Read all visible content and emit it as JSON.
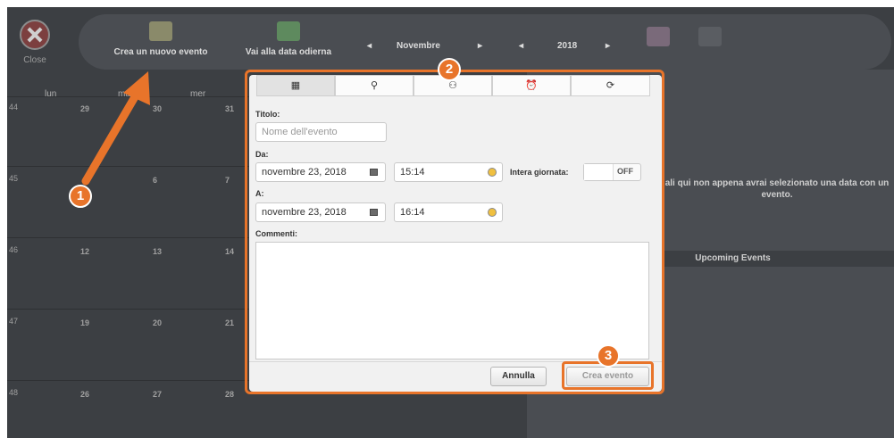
{
  "topbar": {
    "close_label": "Close",
    "new_event_label": "Crea un nuovo evento",
    "today_label": "Vai alla data odierna",
    "month": "Novembre",
    "year": "2018",
    "prev_symbol": "◂",
    "next_symbol": "▸"
  },
  "calendar": {
    "day_headers": [
      "lun",
      "mar",
      "mer"
    ],
    "rows": [
      {
        "week": "44",
        "days": [
          "29",
          "30",
          "31"
        ]
      },
      {
        "week": "45",
        "days": [
          "",
          "6",
          "7"
        ]
      },
      {
        "week": "46",
        "days": [
          "12",
          "13",
          "14"
        ]
      },
      {
        "week": "47",
        "days": [
          "19",
          "20",
          "21"
        ]
      },
      {
        "week": "48",
        "days": [
          "26",
          "27",
          "28"
        ]
      }
    ]
  },
  "right_panel": {
    "message": "ali qui non appena avrai selezionato una data con un evento.",
    "upcoming": "Upcoming Events"
  },
  "dialog": {
    "tabs": [
      {
        "icon": "calendar-icon",
        "glyph": "▦"
      },
      {
        "icon": "location-icon",
        "glyph": "⚲"
      },
      {
        "icon": "people-icon",
        "glyph": "⚇"
      },
      {
        "icon": "alarm-icon",
        "glyph": "⏰"
      },
      {
        "icon": "repeat-icon",
        "glyph": "⟳"
      }
    ],
    "title_label": "Titolo:",
    "title_placeholder": "Nome dell'evento",
    "from_label": "Da:",
    "from_date": "novembre 23, 2018",
    "from_time": "15:14",
    "allday_label": "Intera giornata:",
    "allday_value": "OFF",
    "to_label": "A:",
    "to_date": "novembre 23, 2018",
    "to_time": "16:14",
    "comments_label": "Commenti:",
    "cancel_label": "Annulla",
    "create_label": "Crea evento"
  },
  "annotations": {
    "step1": "1",
    "step2": "2",
    "step3": "3",
    "accent_color": "#e8742a"
  }
}
